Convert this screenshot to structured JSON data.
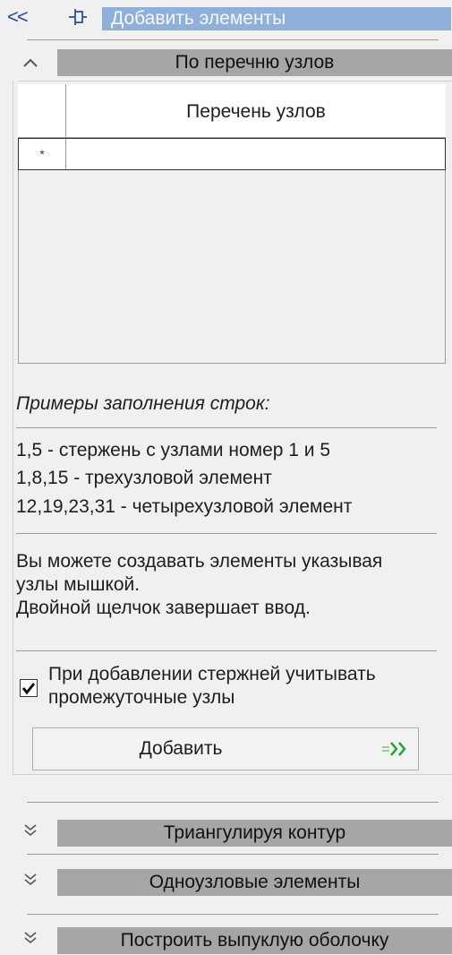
{
  "header": {
    "collapse_label": "<<",
    "pin_icon": "pin-icon",
    "title": "Добавить элементы"
  },
  "sections": {
    "by_nodes": {
      "chevron": "^",
      "title": "По перечню узлов"
    },
    "triangulate": {
      "chevron": "v",
      "title": "Триангулируя контур"
    },
    "single_node": {
      "chevron": "v",
      "title": "Одноузловые элементы"
    },
    "convex_hull": {
      "chevron": "v",
      "title": "Построить выпуклую оболочку"
    }
  },
  "grid": {
    "column_header": "Перечень узлов",
    "new_row_marker": "*",
    "rows": []
  },
  "examples": {
    "title": "Примеры заполнения строк:",
    "lines": [
      "1,5 - стержень с узлами номер 1 и 5",
      "1,8,15 - трехузловой элемент",
      "12,19,23,31 - четырехузловой элемент"
    ]
  },
  "info": {
    "lines": [
      "Вы можете создавать элементы указывая",
      "узлы мышкой.",
      "Двойной щелчок завершает ввод."
    ]
  },
  "option": {
    "checked": true,
    "label_line1": "При добавлении стержней учитывать",
    "label_line2": "промежуточные узлы"
  },
  "add_button": {
    "label": "Добавить",
    "icon": "double-chevron-right-icon"
  },
  "colors": {
    "header_bar": "#8fb0d9",
    "section_bar": "#a6a6a6",
    "accent_green": "#2aa33a"
  }
}
